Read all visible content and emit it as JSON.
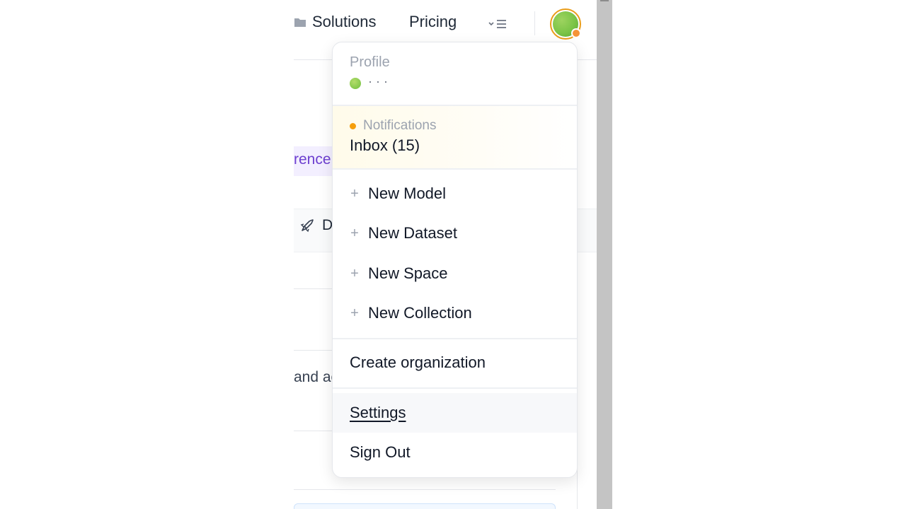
{
  "nav": {
    "solutions_label": "Solutions",
    "pricing_label": "Pricing",
    "more_icon": "chevron-menu-icon",
    "avatar_icon": "user-avatar-icon"
  },
  "background": {
    "purple_fragment": "rence",
    "deploy_fragment": "D",
    "text_fragment": "and ac"
  },
  "menu": {
    "profile": {
      "label": "Profile",
      "name": "· · ·"
    },
    "notifications": {
      "label": "Notifications",
      "inbox": "Inbox (15)"
    },
    "create_items": [
      {
        "label": "New Model"
      },
      {
        "label": "New Dataset"
      },
      {
        "label": "New Space"
      },
      {
        "label": "New Collection"
      }
    ],
    "create_org": "Create organization",
    "settings": "Settings",
    "sign_out": "Sign Out"
  },
  "colors": {
    "accent_orange": "#f59e0b",
    "avatar_ring": "#ea9c18",
    "link_purple": "#6d3fd0",
    "avatar_green": "#7bc447"
  }
}
